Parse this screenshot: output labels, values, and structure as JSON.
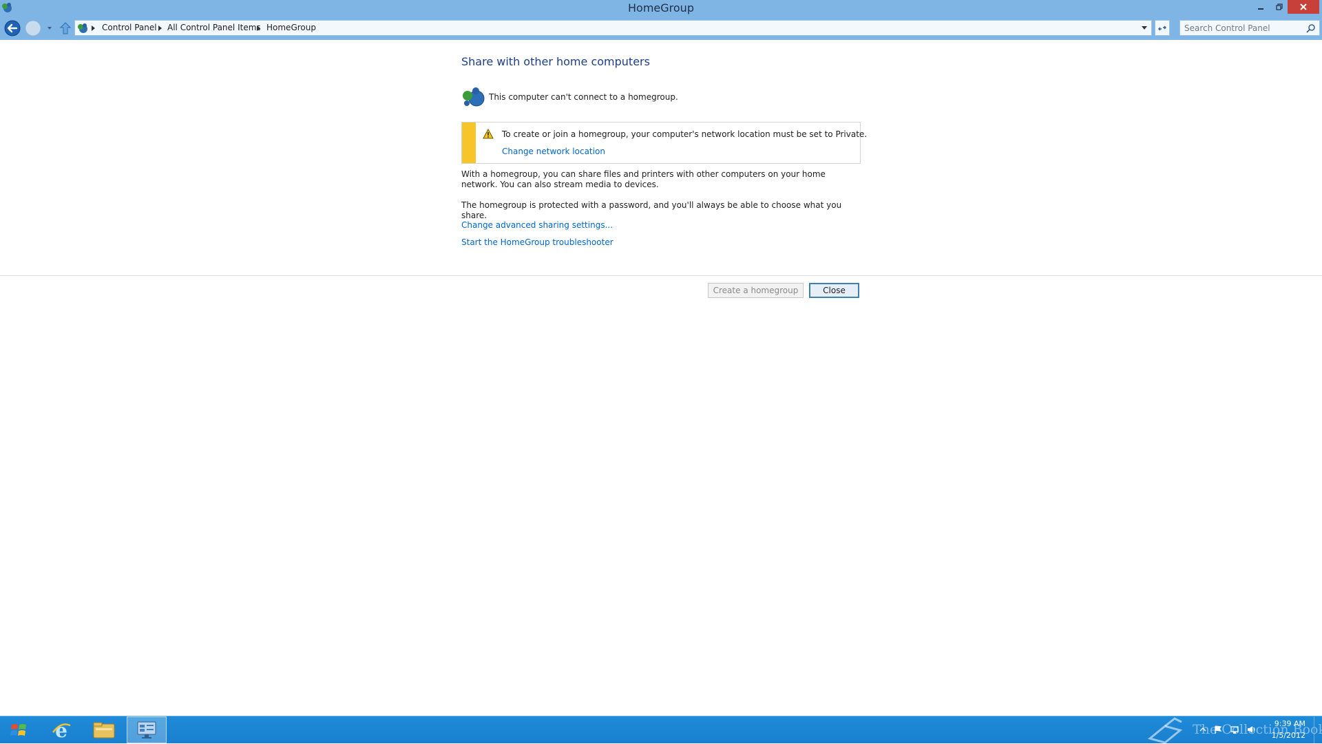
{
  "window": {
    "title": "HomeGroup"
  },
  "nav": {
    "breadcrumbs": [
      "Control Panel",
      "All Control Panel Items",
      "HomeGroup"
    ]
  },
  "search": {
    "placeholder": "Search Control Panel"
  },
  "content": {
    "page_title": "Share with other home computers",
    "status_text": "This computer can't connect to a homegroup.",
    "warning": {
      "text": "To create or join a homegroup, your computer's network location must be set to Private.",
      "link": "Change network location"
    },
    "paragraph1": "With a homegroup, you can share files and printers with other computers on your home network. You can also stream media to devices.",
    "paragraph2": "The homegroup is protected with a password, and you'll always be able to choose what you share.",
    "links": {
      "advanced_sharing": "Change advanced sharing settings...",
      "troubleshooter": "Start the HomeGroup troubleshooter"
    }
  },
  "buttons": {
    "create": "Create a homegroup",
    "close": "Close"
  },
  "taskbar": {
    "apps": [
      "internet-explorer-icon",
      "file-explorer-icon",
      "control-panel-icon"
    ],
    "watermark": "The Collection Book",
    "clock_time": "9:39 AM",
    "clock_date": "1/5/2012"
  },
  "colors": {
    "titlebar": "#7fb5e4",
    "taskbar": "#1a7fcf",
    "link": "#0066cc",
    "heading": "#1e3d8a",
    "warning_stripe": "#f7c42a",
    "close_caption": "#c7413a"
  }
}
